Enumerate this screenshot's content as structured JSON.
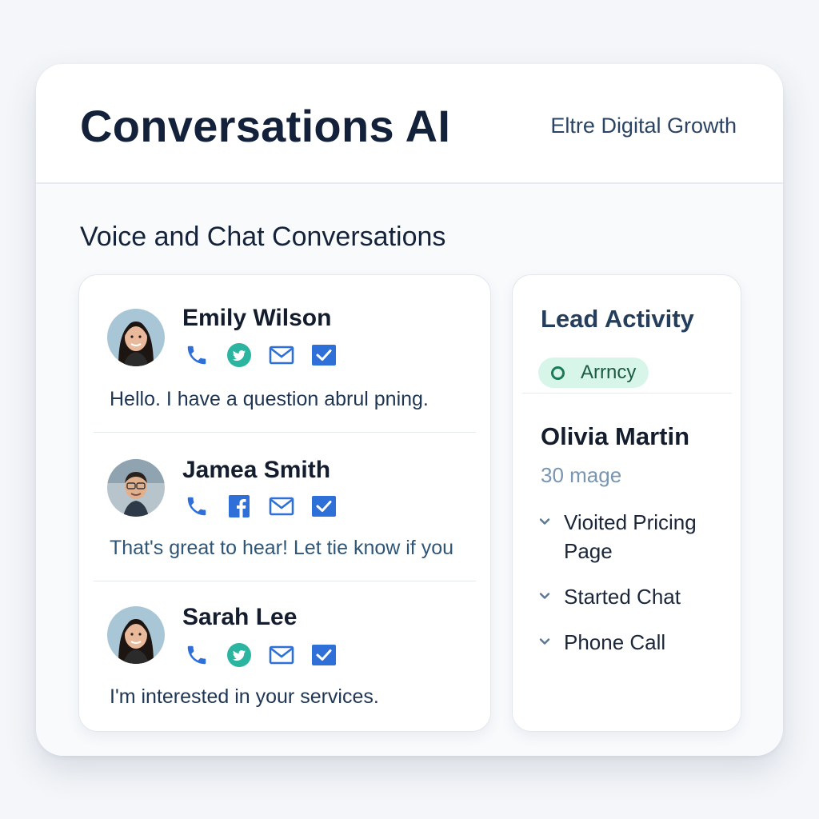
{
  "header": {
    "title": "Conversations AI",
    "company": "Eltre Digital Growth"
  },
  "section": {
    "title": "Voice and Chat Conversations"
  },
  "conversations": [
    {
      "name": "Emily Wilson",
      "channels": [
        "phone-icon",
        "twitter-icon",
        "email-icon",
        "checkbox-icon"
      ],
      "message": "Hello. I have a question abrul pning."
    },
    {
      "name": "Jamea Smith",
      "channels": [
        "phone-icon",
        "facebook-icon",
        "email-icon",
        "checkbox-icon"
      ],
      "message": "That's great to hear! Let tie know if you"
    },
    {
      "name": "Sarah Lee",
      "channels": [
        "phone-icon",
        "twitter-icon",
        "email-icon",
        "checkbox-icon"
      ],
      "message": "I'm interested in your services."
    }
  ],
  "lead": {
    "title": "Lead Activity",
    "status": "Arrncy",
    "name": "Olivia Martin",
    "subtitle": "30 mage",
    "activities": [
      {
        "label": "Vioited Pricing Page"
      },
      {
        "label": "Started Chat"
      },
      {
        "label": "Phone Call"
      }
    ]
  },
  "colors": {
    "accent_blue": "#2f6fd8",
    "twitter_teal": "#2bb5a0",
    "status_green_bg": "#d8f5ea",
    "status_green": "#1d7a56"
  }
}
